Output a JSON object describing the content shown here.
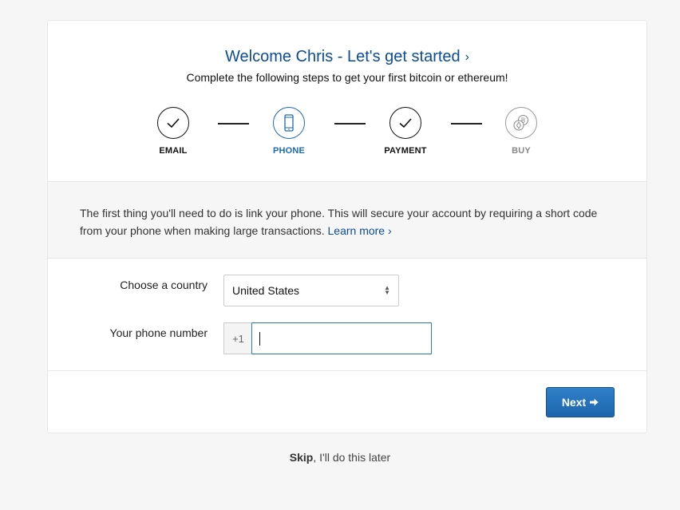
{
  "header": {
    "title": "Welcome Chris - Let's get started",
    "title_chevron": "›",
    "subtitle": "Complete the following steps to get your first bitcoin or ethereum!"
  },
  "steps": [
    {
      "label": "EMAIL",
      "state": "complete",
      "icon": "check-icon"
    },
    {
      "label": "PHONE",
      "state": "active",
      "icon": "phone-icon"
    },
    {
      "label": "PAYMENT",
      "state": "complete",
      "icon": "check-icon"
    },
    {
      "label": "BUY",
      "state": "disabled",
      "icon": "coins-icon"
    }
  ],
  "info": {
    "text": "The first thing you'll need to do is link your phone. This will secure your account by requiring a short code from your phone when making large transactions.",
    "link": "Learn more",
    "link_chevron": "›"
  },
  "form": {
    "country_label": "Choose a country",
    "country_value": "United States",
    "phone_label": "Your phone number",
    "phone_prefix": "+1",
    "phone_value": ""
  },
  "actions": {
    "next_label": "Next",
    "skip_bold": "Skip",
    "skip_rest": ", I'll do this later"
  },
  "colors": {
    "accent": "#1c6ab3",
    "title": "#0c4c96",
    "button": "#1d66ad"
  }
}
